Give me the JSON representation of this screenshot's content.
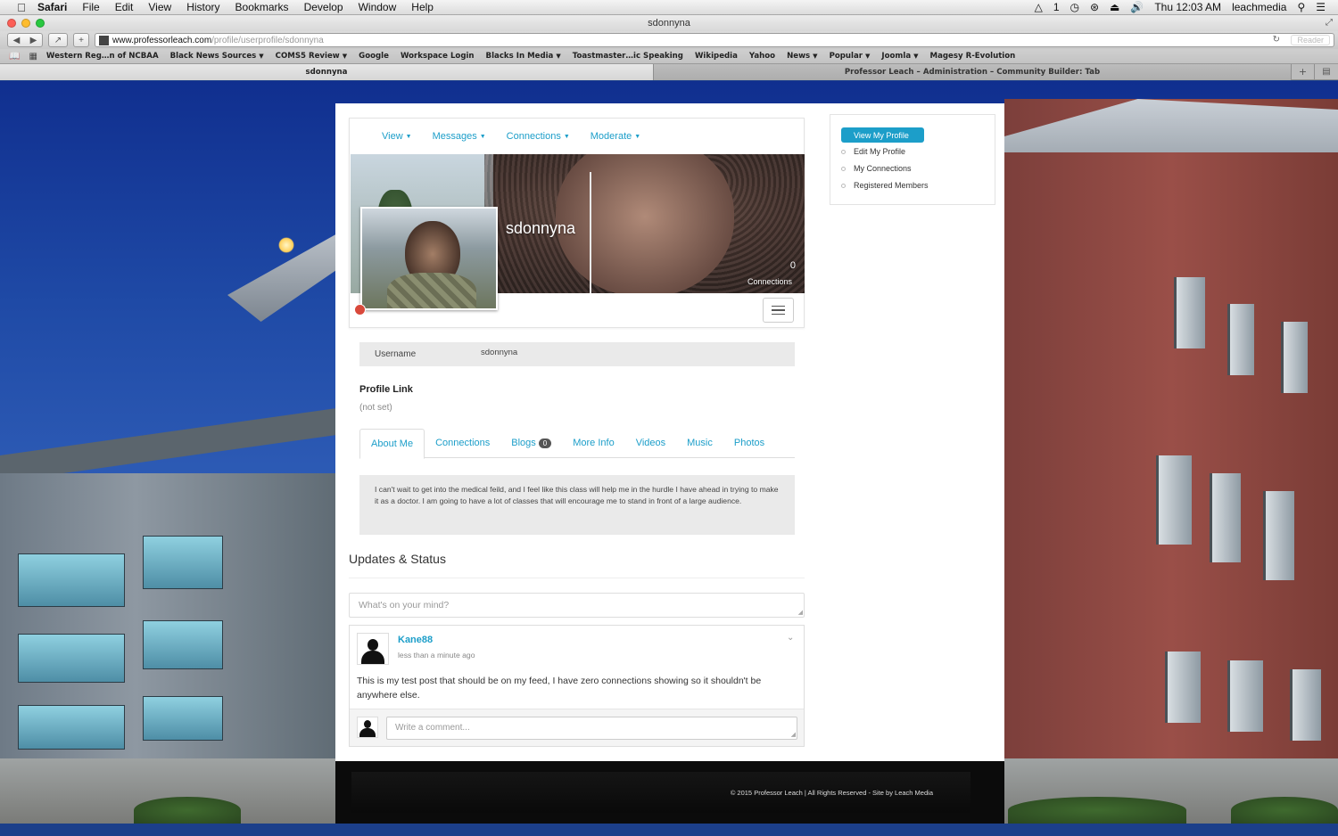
{
  "menubar": {
    "app": "Safari",
    "items": [
      "File",
      "Edit",
      "View",
      "History",
      "Bookmarks",
      "Develop",
      "Window",
      "Help"
    ],
    "status_count": "1",
    "clock": "Thu 12:03 AM",
    "user": "leachmedia"
  },
  "window": {
    "title": "sdonnyna"
  },
  "toolbar": {
    "url_host": "www.professorleach.com",
    "url_path": "/profile/userprofile/sdonnyna",
    "reader_label": "Reader"
  },
  "bookmarks": [
    {
      "label": "Western Reg…n of NCBAA",
      "dropdown": false
    },
    {
      "label": "Black News Sources",
      "dropdown": true
    },
    {
      "label": "COMS5 Review",
      "dropdown": true
    },
    {
      "label": "Google",
      "dropdown": false
    },
    {
      "label": "Workspace Login",
      "dropdown": false
    },
    {
      "label": "Blacks In Media",
      "dropdown": true
    },
    {
      "label": "Toastmaster…ic Speaking",
      "dropdown": false
    },
    {
      "label": "Wikipedia",
      "dropdown": false
    },
    {
      "label": "Yahoo",
      "dropdown": false
    },
    {
      "label": "News",
      "dropdown": true
    },
    {
      "label": "Popular",
      "dropdown": true
    },
    {
      "label": "Joomla",
      "dropdown": true
    },
    {
      "label": "Magesy R-Evolution",
      "dropdown": false
    }
  ],
  "tabs": {
    "active": "sdonnyna",
    "inactive": "Professor Leach – Administration – Community Builder: Tab"
  },
  "profile_nav": [
    "View",
    "Messages",
    "Connections",
    "Moderate"
  ],
  "profile": {
    "username_display": "sdonnyna",
    "connections_count": "0",
    "connections_label": "Connections",
    "username_label": "Username",
    "username_value": "sdonnyna",
    "profile_link_title": "Profile Link",
    "profile_link_value": "(not set)"
  },
  "content_tabs": [
    {
      "label": "About Me",
      "badge": null,
      "active": true
    },
    {
      "label": "Connections",
      "badge": null,
      "active": false
    },
    {
      "label": "Blogs",
      "badge": "0",
      "active": false
    },
    {
      "label": "More Info",
      "badge": null,
      "active": false
    },
    {
      "label": "Videos",
      "badge": null,
      "active": false
    },
    {
      "label": "Music",
      "badge": null,
      "active": false
    },
    {
      "label": "Photos",
      "badge": null,
      "active": false
    }
  ],
  "about_text": "I can't wait to get into the medical feild, and I feel like this class will help me in the hurdle I have ahead in trying to make it as a doctor. I am going to have a lot of classes that will encourage me to stand in front of a large audience.",
  "updates": {
    "title": "Updates & Status",
    "status_placeholder": "What's on your mind?",
    "post": {
      "author": "Kane88",
      "time": "less than a minute ago",
      "body": "This is my test post that should be on my feed, I have zero connections showing so it shouldn't be anywhere else.",
      "comment_placeholder": "Write a comment..."
    }
  },
  "sidebar": {
    "active": "View My Profile",
    "items": [
      "Edit My Profile",
      "My Connections",
      "Registered Members"
    ]
  },
  "footer": {
    "text": "© 2015 Professor Leach | All Rights Reserved - Site by Leach Media"
  },
  "colors": {
    "accent": "#1c9ec9",
    "online_dot": "#d9493b",
    "footer_bg": "#0b0b0b"
  }
}
